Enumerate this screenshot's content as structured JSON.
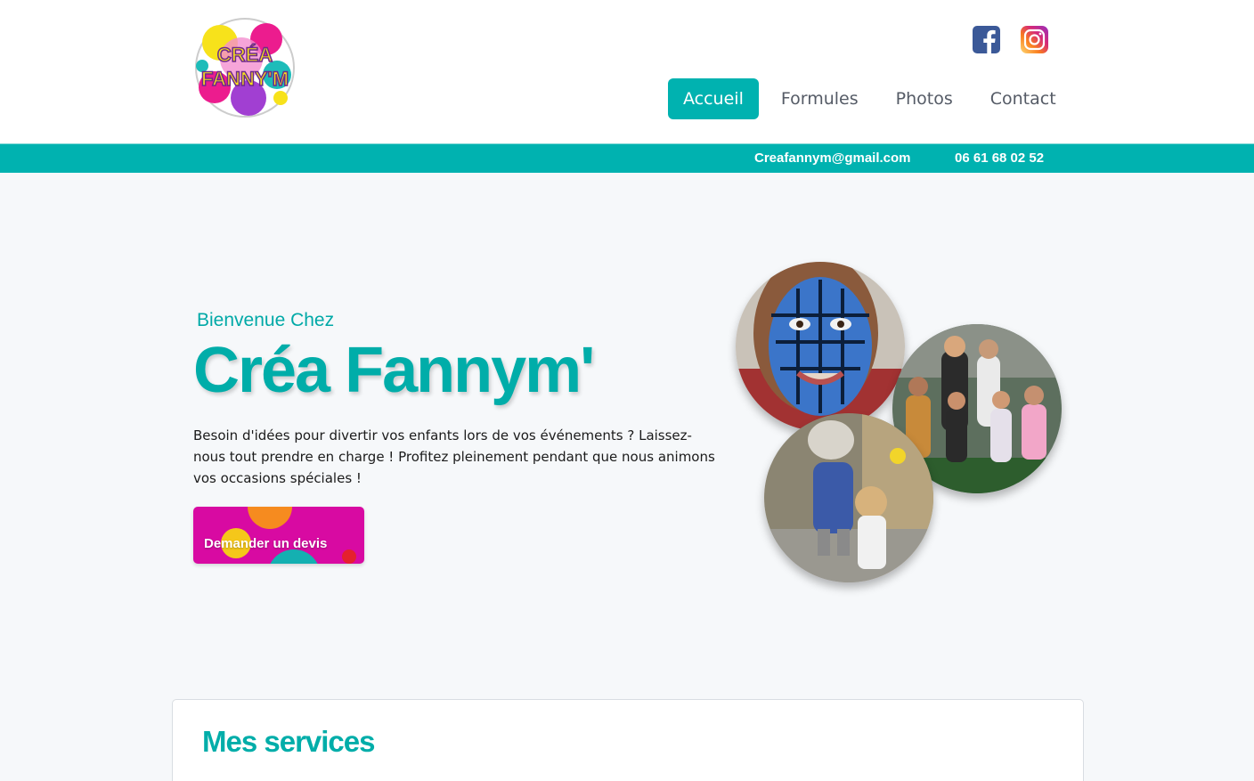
{
  "header": {
    "logo_alt": "Créa Fanny'm",
    "logo_text_top": "CRÉA",
    "logo_text_bottom": "FANNY'M",
    "social": [
      {
        "name": "facebook-icon",
        "color": "#3b5998"
      },
      {
        "name": "instagram-icon",
        "color": "#e1306c"
      }
    ],
    "nav": [
      {
        "label": "Accueil",
        "active": true
      },
      {
        "label": "Formules",
        "active": false
      },
      {
        "label": "Photos",
        "active": false
      },
      {
        "label": "Contact",
        "active": false
      }
    ]
  },
  "topbar": {
    "email": "Creafannym@gmail.com",
    "phone": "06 61 68 02 52"
  },
  "hero": {
    "subtitle": "Bienvenue Chez",
    "title": "Créa Fannym'",
    "text": "Besoin d'idées pour divertir vos enfants lors de vos événements ? Laissez-nous tout prendre en charge ! Profitez pleinement pendant que nous animons vos occasions spéciales !",
    "cta_label": "Demander un devis",
    "photos": [
      {
        "name": "face-paint-photo"
      },
      {
        "name": "group-kids-photo"
      },
      {
        "name": "mascot-photo"
      }
    ]
  },
  "services": {
    "title": "Mes services"
  },
  "colors": {
    "accent": "#00b2b0",
    "cta": "#d80aa2"
  }
}
